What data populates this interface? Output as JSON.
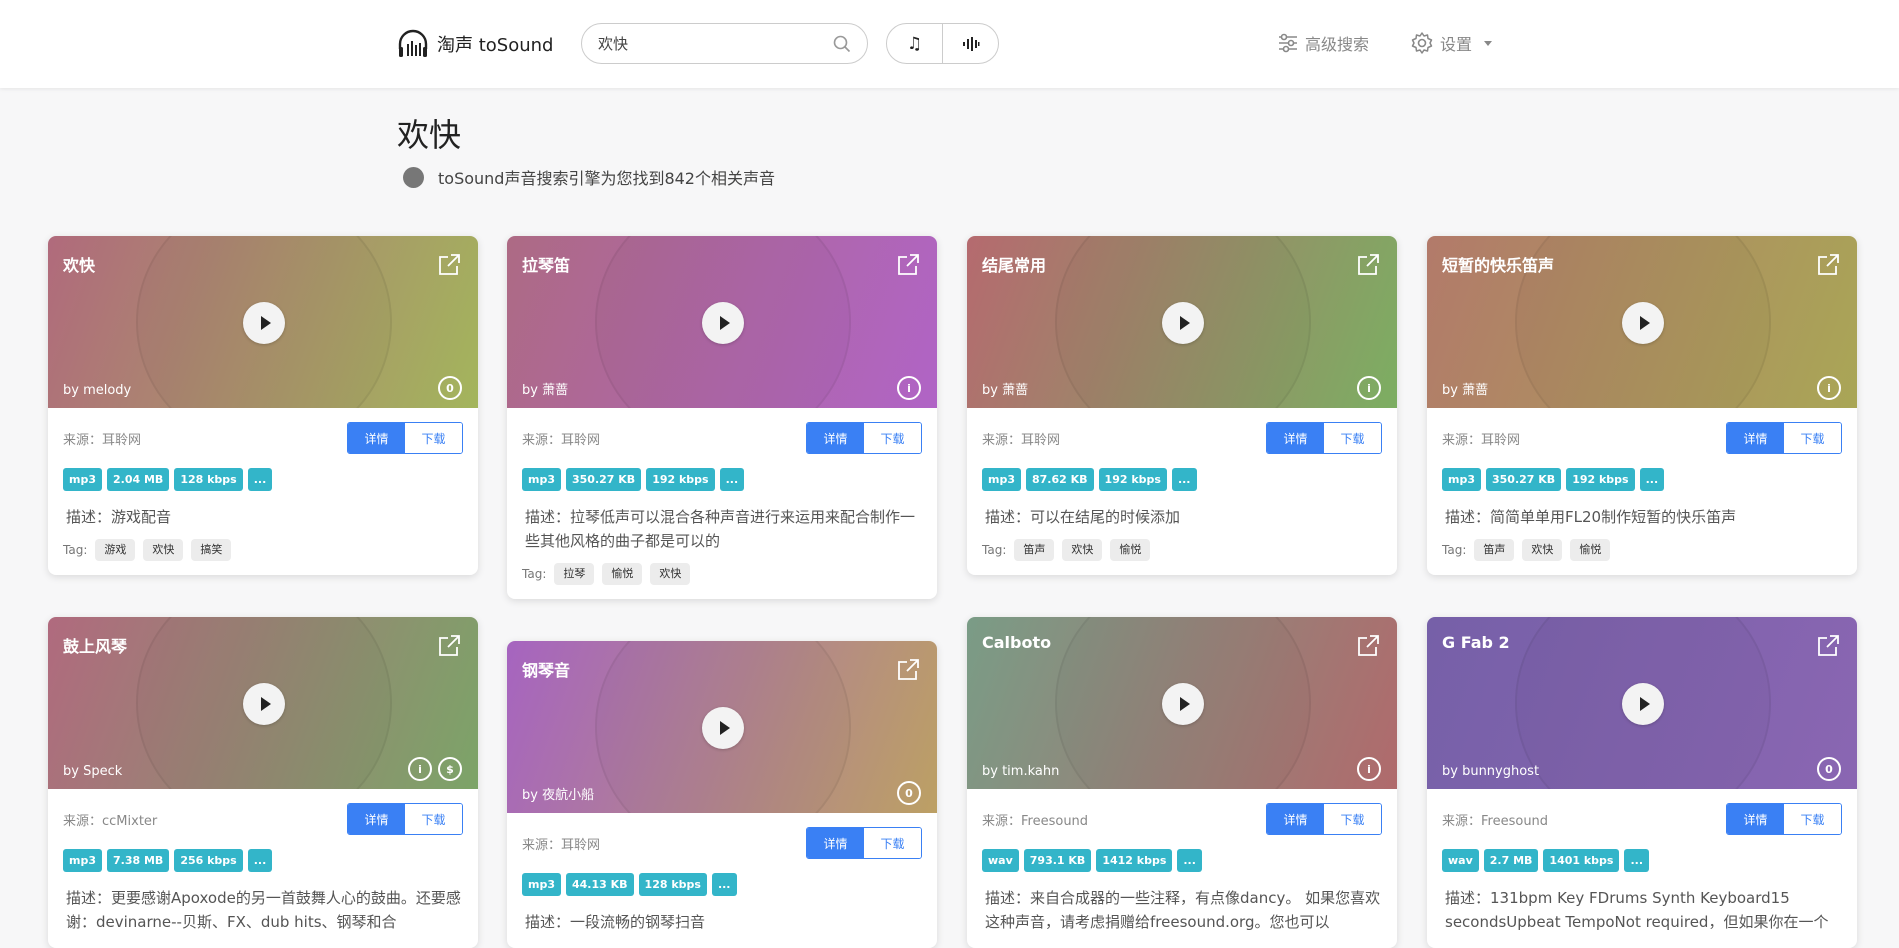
{
  "header": {
    "logo_text": "淘声 toSound",
    "search_value": "欢快",
    "advanced_label": "高级搜索",
    "settings_label": "设置"
  },
  "main": {
    "title": "欢快",
    "result_text": "toSound声音搜索引擎为您找到842个相关声音"
  },
  "labels": {
    "detail": "详情",
    "download": "下载",
    "desc_prefix": "描述：",
    "tag_prefix": "Tag:",
    "more": "..."
  },
  "cards": [
    {
      "title": "欢快",
      "author": "by melody",
      "source": "来源：耳聆网",
      "format": "mp3",
      "size": "2.04 MB",
      "bitrate": "128 kbps",
      "desc": "游戏配音",
      "tags": [
        "游戏",
        "欢快",
        "搞笑"
      ],
      "colors": [
        "#b06a7c",
        "#a3b55c"
      ],
      "licenses": [
        "cc0"
      ]
    },
    {
      "title": "拉琴笛",
      "author": "by 萧蔷",
      "source": "来源：耳聆网",
      "format": "mp3",
      "size": "350.27 KB",
      "bitrate": "192 kbps",
      "desc": "拉琴低声可以混合各种声音进行来运用来配合制作一些其他风格的曲子都是可以的",
      "tags": [
        "拉琴",
        "愉悦",
        "欢快"
      ],
      "colors": [
        "#ad6a84",
        "#b064c6"
      ],
      "licenses": [
        "by"
      ]
    },
    {
      "title": "结尾常用",
      "author": "by 萧蔷",
      "source": "来源：耳聆网",
      "format": "mp3",
      "size": "87.62 KB",
      "bitrate": "192 kbps",
      "desc": "可以在结尾的时候添加",
      "tags": [
        "笛声",
        "欢快",
        "愉悦"
      ],
      "colors": [
        "#b56a6f",
        "#7cae62"
      ],
      "licenses": [
        "by"
      ]
    },
    {
      "title": "短暂的快乐笛声",
      "author": "by 萧蔷",
      "source": "来源：耳聆网",
      "format": "mp3",
      "size": "350.27 KB",
      "bitrate": "192 kbps",
      "desc": "简简单单用FL20制作短暂的快乐笛声",
      "tags": [
        "笛声",
        "欢快",
        "愉悦"
      ],
      "colors": [
        "#b27a6a",
        "#a9a656"
      ],
      "licenses": [
        "by"
      ]
    },
    {
      "title": "鼓上风琴",
      "author": "by Speck",
      "source": "来源：ccMixter",
      "format": "mp3",
      "size": "7.38 MB",
      "bitrate": "256 kbps",
      "desc": "更要感谢Apoxode的另一首鼓舞人心的鼓曲。还要感谢：devinarne--贝斯、FX、dub hits、钢琴和合",
      "tags": [],
      "colors": [
        "#b06a7e",
        "#7ca468"
      ],
      "licenses": [
        "by",
        "nc"
      ]
    },
    {
      "title": "钢琴音",
      "author": "by 夜航小船",
      "source": "来源：耳聆网",
      "format": "mp3",
      "size": "44.13 KB",
      "bitrate": "128 kbps",
      "desc": "一段流畅的钢琴扫音",
      "tags": [],
      "colors": [
        "#a664c0",
        "#bca064"
      ],
      "licenses": [
        "cc0"
      ]
    },
    {
      "title": "Calboto",
      "author": "by tim.kahn",
      "source": "来源：Freesound",
      "format": "wav",
      "size": "793.1 KB",
      "bitrate": "1412 kbps",
      "desc": "来自合成器的一些注释，有点像dancy。 如果您喜欢这种声音，请考虑捐赠给freesound.org。您也可以",
      "tags": [],
      "colors": [
        "#7a9c86",
        "#b06a6c"
      ],
      "licenses": [
        "by"
      ]
    },
    {
      "title": "G Fab 2",
      "author": "by bunnyghost",
      "source": "来源：Freesound",
      "format": "wav",
      "size": "2.7 MB",
      "bitrate": "1401 kbps",
      "desc": "131bpm Key FDrums Synth Keyboard15 secondsUpbeat TempoNot required，但如果你在一个",
      "tags": [],
      "colors": [
        "#7660a8",
        "#8a66b2"
      ],
      "licenses": [
        "cc0"
      ]
    }
  ]
}
